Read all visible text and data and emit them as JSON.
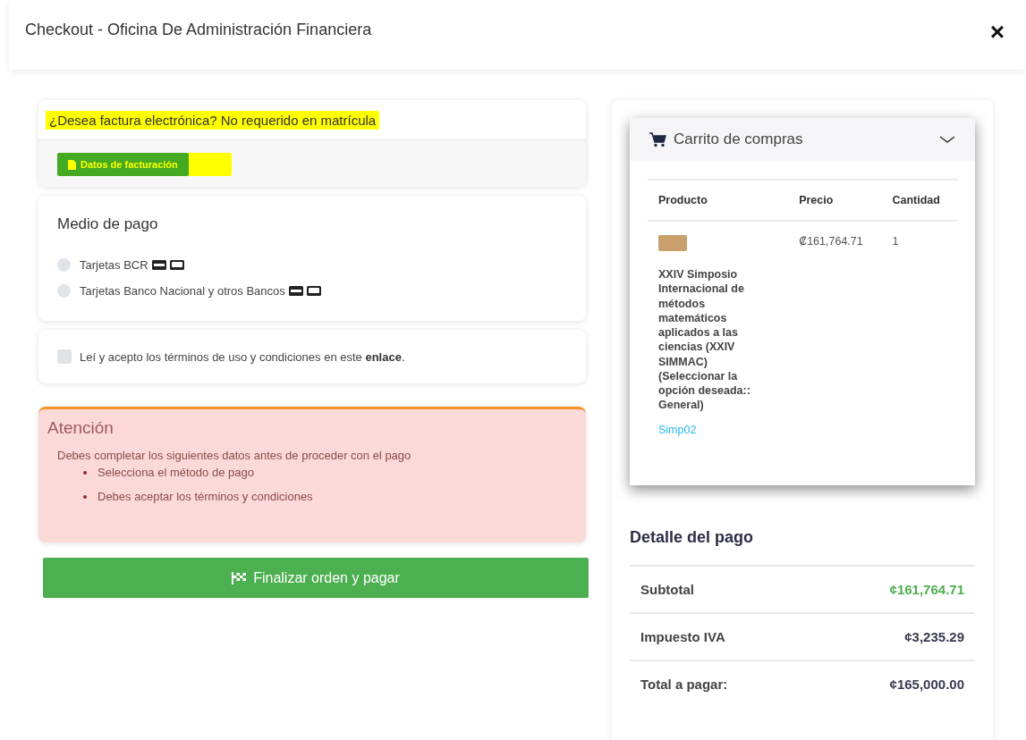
{
  "header": {
    "title": "Checkout - Oficina De Administración Financiera",
    "close": "×"
  },
  "invoice": {
    "question": "¿Desea factura electrónica? No requerido en matrícula",
    "question_highlighted": true,
    "button": "Datos de facturación",
    "button_highlighted": true
  },
  "payment": {
    "title": "Medio de pago",
    "options": [
      {
        "label": "Tarjetas BCR",
        "selected": false
      },
      {
        "label": "Tarjetas Banco Nacional y otros Bancos",
        "selected": false
      }
    ]
  },
  "terms": {
    "text": "Leí y acepto los términos de uso y condiciones en este",
    "link": "enlace",
    "end": ".",
    "checked": false
  },
  "alert": {
    "title": "Atención",
    "message": "Debes completar los siguientes datos antes de proceder con el pago",
    "items": [
      "Selecciona el método de pago",
      "Debes aceptar los términos y condiciones"
    ]
  },
  "submit": "Finalizar orden y pagar",
  "cart": {
    "title": "Carrito de compras",
    "expanded": true,
    "columns": [
      "Producto",
      "Precio",
      "Cantidad"
    ],
    "rows": [
      {
        "name": "XXIV Simposio Internacional de métodos matemáticos aplicados a las ciencias (XXIV SIMMAC) (Seleccionar la opción deseada:: General)",
        "code": "Simp02",
        "price": "₡161,764.71",
        "quantity": "1"
      }
    ]
  },
  "summary": {
    "title": "Detalle del pago",
    "rows": [
      {
        "label": "Subtotal",
        "value": "¢161,764.71",
        "accent": true
      },
      {
        "label": "Impuesto IVA",
        "value": "¢3,235.29",
        "accent": false
      },
      {
        "label": "Total a pagar:",
        "value": "¢165,000.00",
        "accent": false
      }
    ]
  }
}
